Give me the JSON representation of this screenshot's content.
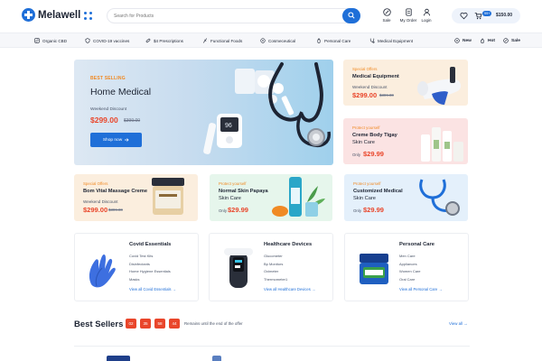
{
  "header": {
    "logo_text": "Melawell",
    "search_placeholder": "Search for Products",
    "icons": [
      {
        "label": "Sale",
        "icon": "percent-icon"
      },
      {
        "label": "My Order",
        "icon": "order-icon"
      },
      {
        "label": "Login",
        "icon": "user-icon"
      }
    ],
    "cart_count": "99+",
    "cart_total": "$150.00"
  },
  "nav": {
    "items": [
      "Organic CBD",
      "COVID-19 vaccines",
      "$4 Prescriptions",
      "Functional Foods",
      "Cosmeceutical",
      "Personal Care",
      "Medical Equipment"
    ],
    "right": [
      "New",
      "Hot",
      "Sale"
    ]
  },
  "hero": {
    "eyebrow": "BEST SELLING",
    "title": "Home Medical",
    "sub": "Weekend Discount",
    "price": "$299.00",
    "old_price": "$399.00",
    "button": "Shop now"
  },
  "promos": {
    "medical_equipment": {
      "tag": "Special Offers",
      "name": "Medical Equipment",
      "note": "Weekend Discount",
      "price": "$299.00",
      "old_price": "$399.00"
    },
    "creme_body": {
      "tag": "Protect yourself",
      "name": "Creme Body Tigay",
      "sub": "Skin Care",
      "only": "Only",
      "price": "$29.99"
    },
    "massage": {
      "tag": "Special Offers",
      "name": "Bom Vital Massage Creme",
      "note": "Weekend Discount",
      "price": "$299.00",
      "old_price": "$399.00"
    },
    "papaya": {
      "tag": "Protect yourself",
      "name": "Normal Skin Papaya",
      "sub": "Skin Care",
      "only": "Only",
      "price": "$29.99"
    },
    "customized": {
      "tag": "Protect yourself",
      "name": "Customized Medical",
      "sub": "Skin Care",
      "only": "Only",
      "price": "$29.99"
    }
  },
  "categories": [
    {
      "title": "Covid Essentials",
      "items": [
        "Covid Test Kits",
        "Disinfectants",
        "Home Hygiene Essentials",
        "Masks"
      ],
      "link": "View all Covid Essentials"
    },
    {
      "title": "Healthcare Devices",
      "items": [
        "Glucometer",
        "Bp Monitors",
        "Oximeter",
        "Thermometer1"
      ],
      "link": "View all Healthcare Devices"
    },
    {
      "title": "Personal Care",
      "items": [
        "Men Care",
        "Appliances",
        "Women Care",
        "Oral Care"
      ],
      "link": "View all Personal Care"
    }
  ],
  "best_sellers": {
    "title": "Best Sellers",
    "countdown": [
      "02",
      "35",
      "58",
      "44"
    ],
    "note": "Remains until the end of the offer",
    "view_all": "View all"
  },
  "colors": {
    "accent": "#1f6fd8",
    "price": "#e9462b",
    "orange": "#f08a24"
  }
}
